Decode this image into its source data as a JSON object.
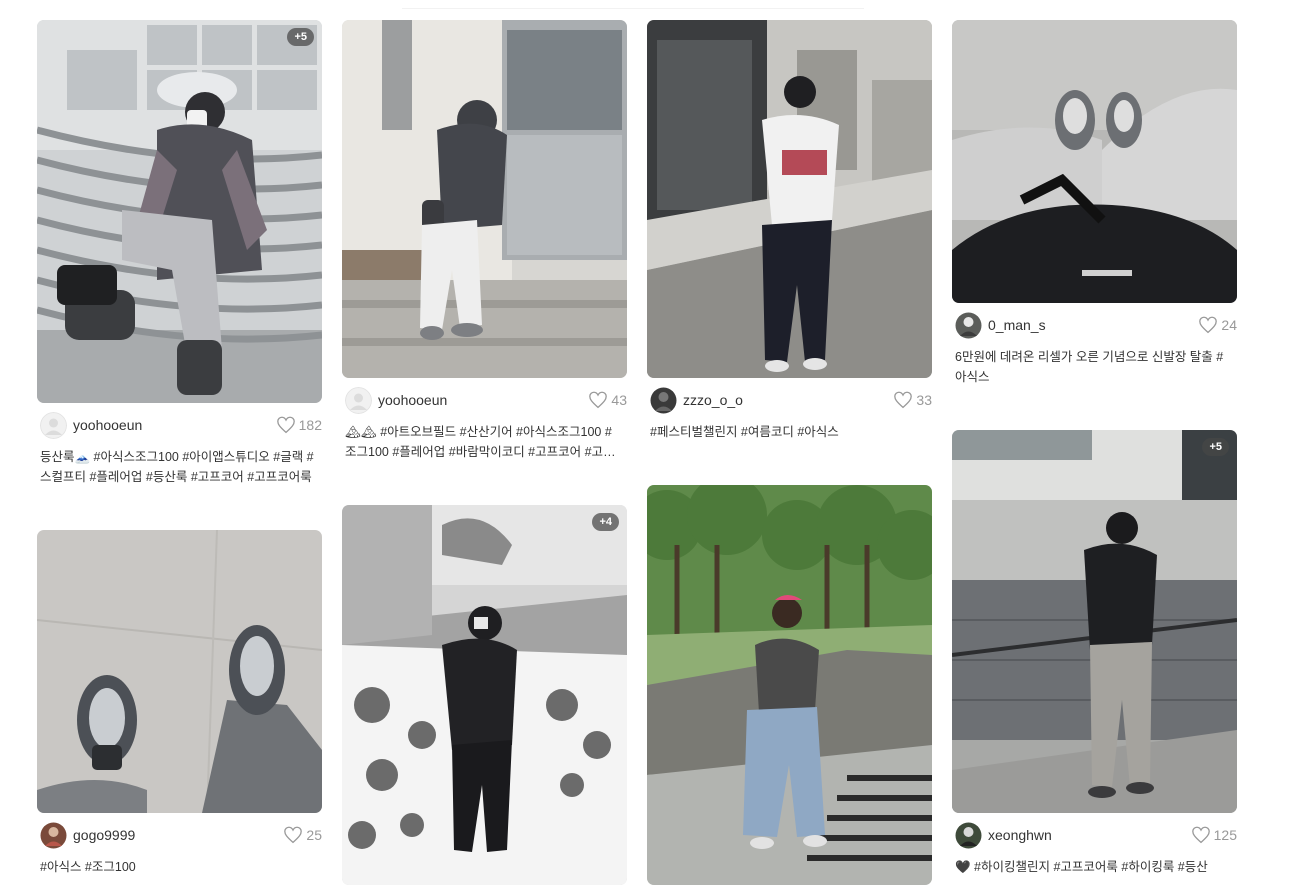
{
  "cards": [
    {
      "username": "yoohooeun",
      "likes": "182",
      "badge": "+5",
      "caption": "등산룩🗻 #아식스조그100 #아이앱스튜디오 #글랙 #스컬프티 #플레어업 #등산룩 #고프코어 #고프코어룩"
    },
    {
      "username": "yoohooeun",
      "likes": "43",
      "badge": "",
      "caption": "🏔🏔 #아트오브필드 #산산기어 #아식스조그100 #조그100 #플레어업 #바람막이코디 #고프코어 #고프코어룩"
    },
    {
      "username": "zzzo_o_o",
      "likes": "33",
      "badge": "",
      "caption": "#페스티벌챌린지 #여름코디 #아식스"
    },
    {
      "username": "0_man_s",
      "likes": "24",
      "badge": "",
      "caption": "6만원에 데려온 리셀가 오른 기념으로 신발장 탈출 #아식스"
    },
    {
      "username": "gogo9999",
      "likes": "25",
      "badge": "",
      "caption": "#아식스 #조그100"
    },
    {
      "username": "",
      "likes": "",
      "badge": "+4",
      "caption": ""
    },
    {
      "username": "",
      "likes": "",
      "badge": "",
      "caption": ""
    },
    {
      "username": "xeonghwn",
      "likes": "125",
      "badge": "+5",
      "caption": "🖤 #하이킹챌린지 #고프코어룩 #하이킹룩 #등산"
    }
  ],
  "icons": {
    "like": "heart-outline-icon",
    "avatar_default": "user-avatar-placeholder"
  },
  "colors": {
    "like_gray": "#999999",
    "badge_bg": "#464646"
  }
}
